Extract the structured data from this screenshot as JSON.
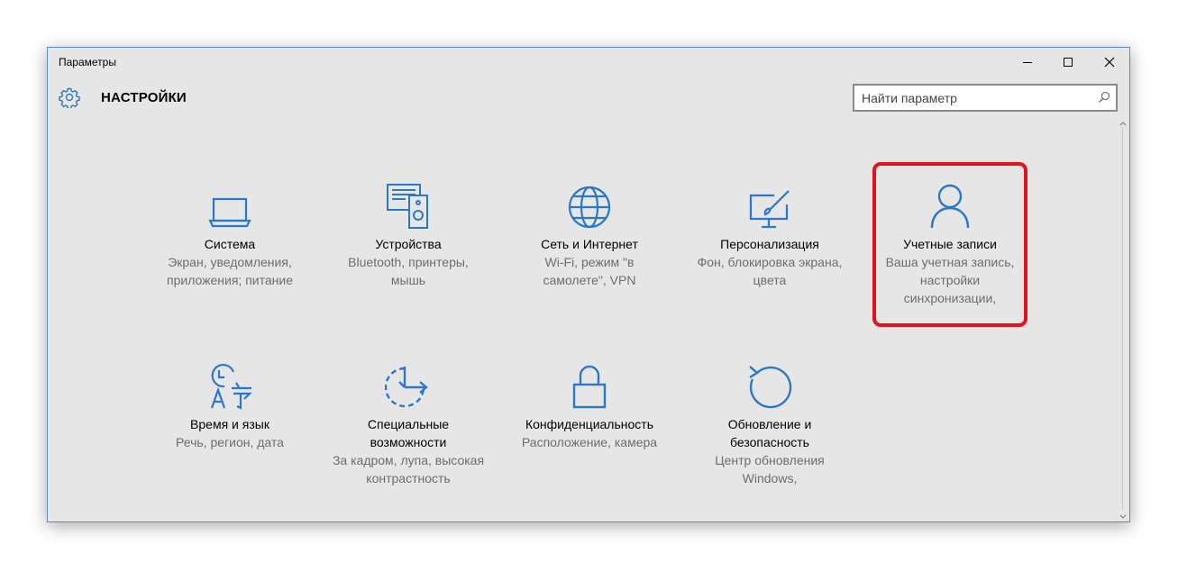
{
  "window": {
    "title": "Параметры"
  },
  "header": {
    "title": "НАСТРОЙКИ"
  },
  "search": {
    "placeholder": "Найти параметр"
  },
  "tiles": [
    {
      "name": "Система",
      "desc": "Экран, уведомления, приложения; питание",
      "icon": "laptop-icon"
    },
    {
      "name": "Устройства",
      "desc": "Bluetooth, принтеры, мышь",
      "icon": "devices-icon"
    },
    {
      "name": "Сеть и Интернет",
      "desc": "Wi-Fi, режим \"в самолете\", VPN",
      "icon": "globe-icon"
    },
    {
      "name": "Персонализация",
      "desc": "Фон, блокировка экрана, цвета",
      "icon": "personalization-icon"
    },
    {
      "name": "Учетные записи",
      "desc": "Ваша учетная запись, настройки синхронизации,",
      "icon": "person-icon"
    },
    {
      "name": "Время и язык",
      "desc": "Речь, регион, дата",
      "icon": "time-language-icon"
    },
    {
      "name": "Специальные возможности",
      "desc": "За кадром, лупа, высокая контрастность",
      "icon": "ease-of-access-icon"
    },
    {
      "name": "Конфиденциальность",
      "desc": "Расположение, камера",
      "icon": "lock-icon"
    },
    {
      "name": "Обновление и безопасность",
      "desc": "Центр обновления Windows,",
      "icon": "update-icon"
    }
  ],
  "colors": {
    "accent": "#2b78c6",
    "highlight": "#e0141e",
    "background": "#e6e6e6"
  }
}
